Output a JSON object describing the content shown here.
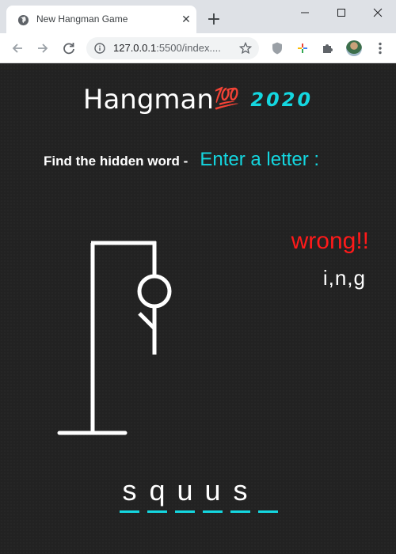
{
  "browser": {
    "tab_title": "New Hangman Game",
    "url_host": "127.0.0.1",
    "url_rest": ":5500/index....",
    "icons": [
      "globe-icon",
      "close-icon",
      "plus-icon",
      "back-arrow-icon",
      "forward-arrow-icon",
      "reload-icon",
      "info-icon",
      "star-icon",
      "shield-icon",
      "google-icon",
      "puzzle-icon",
      "avatar",
      "more-vert-icon",
      "minimize-icon",
      "maximize-icon",
      "close-window-icon"
    ]
  },
  "game": {
    "title": "Hangman",
    "title_emoji": "💯",
    "year": "2020",
    "prompt": "Find the hidden word -",
    "enter_prompt": "Enter a letter :",
    "status": "wrong!!",
    "wrong_letters": "i,n,g",
    "word_letters": [
      "s",
      "q",
      "u",
      "u",
      "s",
      ""
    ],
    "colors": {
      "accent": "#14d7e0",
      "error": "#ff1a1a",
      "background": "#222222",
      "text": "#ffffff"
    }
  }
}
